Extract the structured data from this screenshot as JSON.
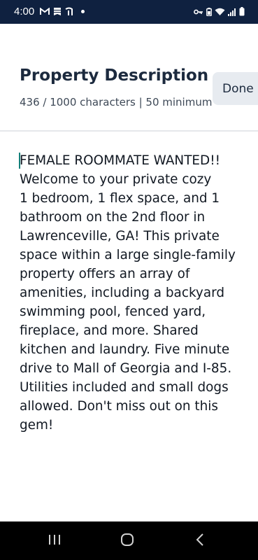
{
  "status_bar": {
    "time": "4:00",
    "left_icons": [
      "gmail-icon",
      "bookmark-icon",
      "app-notification-icon",
      "dot-icon"
    ],
    "right_icons": [
      "key-icon",
      "battery-saver-icon",
      "wifi-icon",
      "signal-icon",
      "battery-icon"
    ]
  },
  "header": {
    "title": "Property Description",
    "char_count": "436 / 1000 characters | 50 minimum",
    "done_label": "Done"
  },
  "description": {
    "text": "FEMALE ROOMMATE WANTED!!\nWelcome to your private cozy\n1 bedroom, 1 flex space, and 1\nbathroom on the 2nd floor in\nLawrenceville, GA! This private\nspace within a large single-family\nproperty offers an array of\namenities,  including a backyard\nswimming pool, fenced yard,\nfireplace, and more. Shared\nkitchen and laundry. Five minute\ndrive to Mall of Georgia and I-85.\nUtilities included and small dogs\nallowed. Don't miss out on this\ngem!"
  },
  "nav_bar": {
    "buttons": [
      "recents-icon",
      "home-icon",
      "back-icon"
    ]
  },
  "colors": {
    "status_bar_bg": "#0f2140",
    "done_button_bg": "#e7ebf0",
    "caret": "#13807a",
    "nav_bar_bg": "#000000"
  }
}
